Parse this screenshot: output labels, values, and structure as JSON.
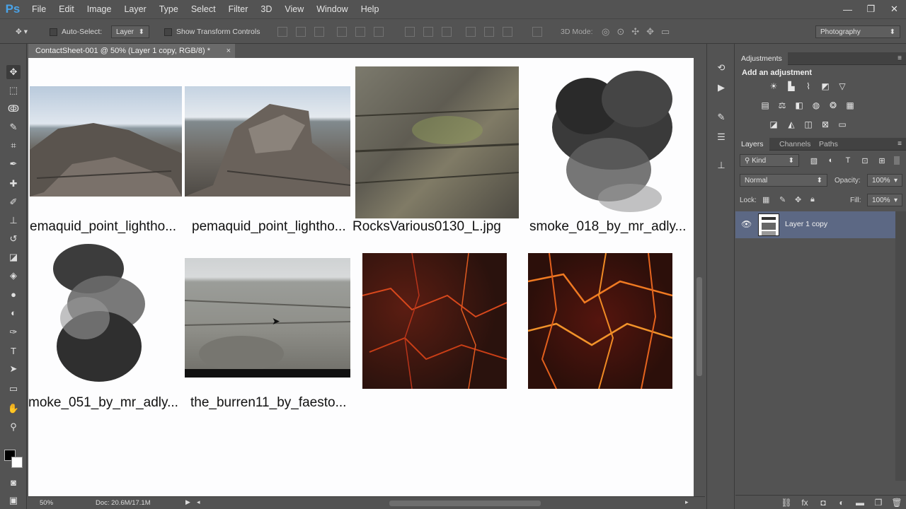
{
  "app": {
    "logo": "Ps"
  },
  "menu": [
    "File",
    "Edit",
    "Image",
    "Layer",
    "Type",
    "Select",
    "Filter",
    "3D",
    "View",
    "Window",
    "Help"
  ],
  "window_controls": {
    "minimize": "—",
    "restore": "❐",
    "close": "✕"
  },
  "options": {
    "auto_select_label": "Auto-Select:",
    "auto_select_value": "Layer",
    "show_transform_label": "Show Transform Controls",
    "mode_3d_label": "3D Mode:",
    "workspace": "Photography"
  },
  "document": {
    "tab_title": "ContactSheet-001 @ 50% (Layer 1 copy, RGB/8) *",
    "zoom": "50%",
    "doc_info": "Doc: 20.6M/17.1M",
    "thumbnails": [
      {
        "label": "emaquid_point_lightho..."
      },
      {
        "label": "pemaquid_point_lightho..."
      },
      {
        "label": "RocksVarious0130_L.jpg"
      },
      {
        "label": "smoke_018_by_mr_adly..."
      },
      {
        "label": "moke_051_by_mr_adly..."
      },
      {
        "label": "the_burren11_by_faesto..."
      }
    ]
  },
  "adjustments": {
    "tab": "Adjustments",
    "heading": "Add an adjustment"
  },
  "layers": {
    "tabs": [
      "Layers",
      "Channels",
      "Paths"
    ],
    "filter_kind": "Kind",
    "blend_mode": "Normal",
    "opacity_label": "Opacity:",
    "opacity_value": "100%",
    "lock_label": "Lock:",
    "fill_label": "Fill:",
    "fill_value": "100%",
    "items": [
      {
        "name": "Layer 1 copy"
      }
    ]
  }
}
